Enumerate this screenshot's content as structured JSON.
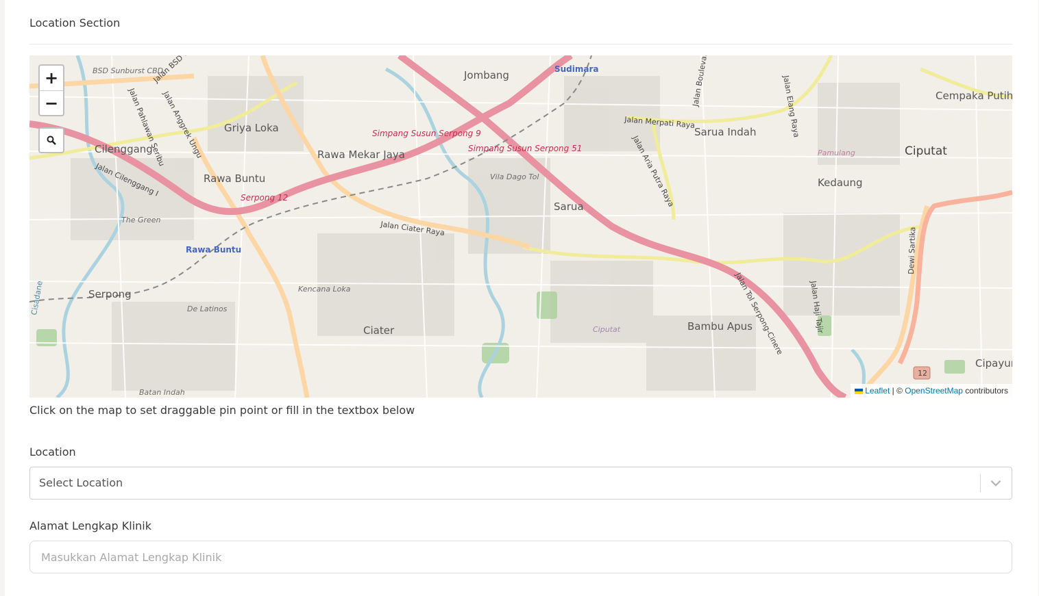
{
  "section": {
    "title": "Location Section"
  },
  "map": {
    "zoom_in_label": "+",
    "zoom_out_label": "−",
    "attribution": {
      "leaflet": "Leaflet",
      "separator": " | © ",
      "osm": "OpenStreetMap",
      "suffix": " contributors"
    },
    "place_labels": [
      "BSD Sunburst CBD",
      "Jalan BSD Grand",
      "Jombang",
      "Sudimara",
      "Griya Loka",
      "Cilenggang",
      "Rawa Mekar Jaya",
      "Simpang Susun Serpong 9",
      "Simpang Susun Serpong 51",
      "Jalan Merpati Raya",
      "Sarua Indah",
      "Cempaka Putih",
      "Ciputat",
      "Kedaung",
      "Rawa Buntu",
      "Serpong 12",
      "Vila Dago Tol",
      "Sarua",
      "Jalan Ciater Raya",
      "The Green",
      "Rawa Buntu",
      "Kencana Loka",
      "Serpong",
      "De Latinos",
      "Ciater",
      "Bambu Apus",
      "Cipayung",
      "Batan Indah",
      "Ciputat",
      "Jalan Tol Serpong-Cinere",
      "Dewi Sartika",
      "Jalan Aria Putra Raya",
      "Jalan Pahlawan Seribu",
      "Jalan Anggrek Ungu",
      "Jalan Cilenggang I",
      "Jalan Boulevard",
      "Jalan Elang Raya",
      "Pamulang",
      "Jalan Haji Tajir",
      "12",
      "Cisadane"
    ]
  },
  "hint": "Click on the map to set draggable pin point or fill in the textbox below",
  "location_field": {
    "label": "Location",
    "value": "Select Location"
  },
  "address_field": {
    "label": "Alamat Lengkap Klinik",
    "placeholder": "Masukkan Alamat Lengkap Klinik"
  },
  "colors": {
    "motorway": "#e892a2",
    "primary": "#fcd6a4",
    "secondary": "#f7fabf",
    "water": "#aad3df",
    "green": "#add19e",
    "trunk": "#f9b29c",
    "link": "#0078a8"
  }
}
